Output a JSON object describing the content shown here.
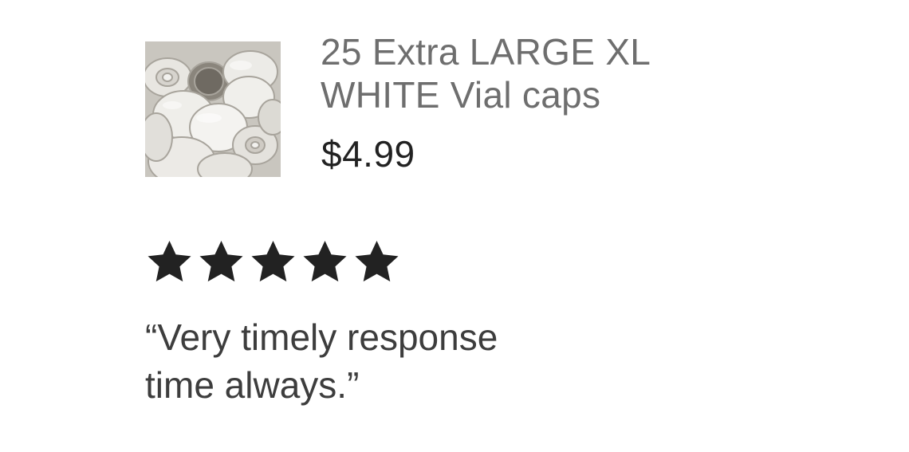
{
  "listing": {
    "thumbnail_alt": "vial-caps-photo",
    "title_line1": "25 Extra LARGE XL",
    "title_line2": "WHITE Vial caps",
    "price": "$4.99"
  },
  "review": {
    "rating": 5,
    "rating_max": 5,
    "star_icon": "star-icon",
    "star_color": "#222222",
    "quote_line1": "“Very timely response",
    "quote_line2": "time always.”"
  }
}
